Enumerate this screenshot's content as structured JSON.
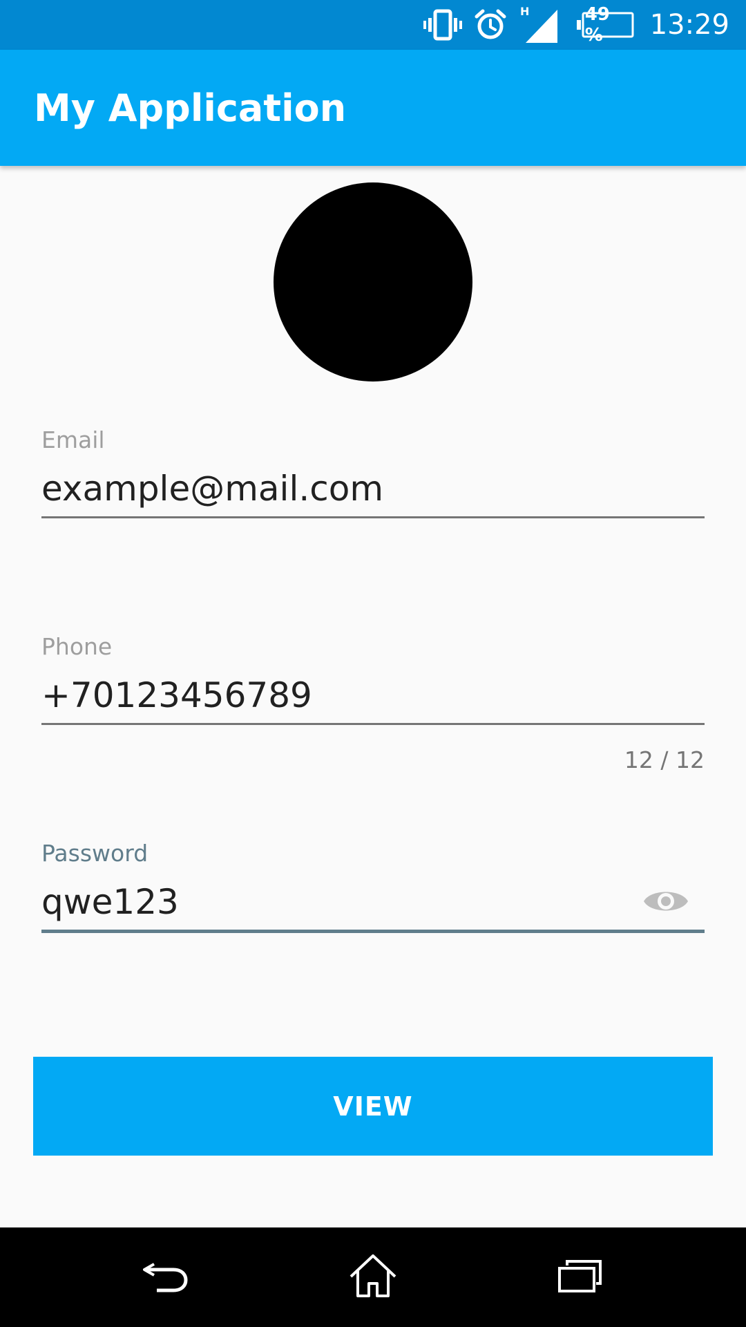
{
  "status_bar": {
    "time": "13:29",
    "battery_percent": "49 %",
    "network_type": "H",
    "icons": [
      "vibrate-icon",
      "alarm-icon",
      "signal-icon",
      "battery-icon"
    ]
  },
  "app_bar": {
    "title": "My Application"
  },
  "avatar": {
    "color": "#000000"
  },
  "form": {
    "email": {
      "label": "Email",
      "value": "example@mail.com"
    },
    "phone": {
      "label": "Phone",
      "value": "+70123456789",
      "counter": "12 / 12"
    },
    "password": {
      "label": "Password",
      "value": "qwe123",
      "toggle_icon": "eye-icon"
    }
  },
  "button": {
    "label": "VIEW"
  },
  "nav_bar": {
    "icons": [
      "back-icon",
      "home-icon",
      "recents-icon"
    ]
  },
  "colors": {
    "status_bar": "#0288d1",
    "app_bar": "#03a9f4",
    "accent_focused": "#607d8b",
    "background": "#fafafa"
  }
}
